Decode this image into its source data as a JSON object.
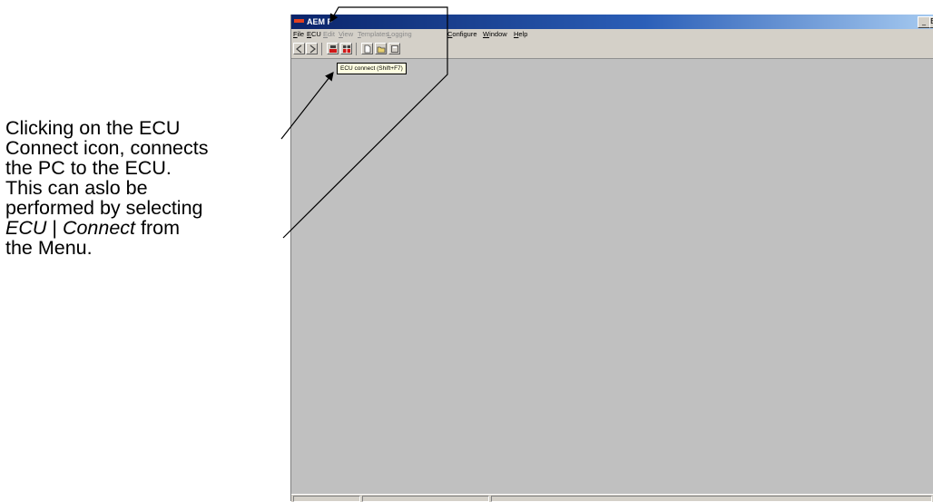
{
  "annotation": {
    "lines": [
      "Clicking on the ECU",
      "Connect icon, connects",
      "the PC to the ECU.",
      "This can aslo be",
      "performed by selecting"
    ],
    "italic_ecu": "ECU",
    "separator": " | ",
    "italic_connect": "Connect",
    "line6_suffix": " from",
    "line7": "the Menu."
  },
  "window": {
    "title": "AEM P",
    "min_glyph": "_",
    "max_glyph": "B",
    "titlebar_color": "#0a246a"
  },
  "menu": {
    "items": [
      {
        "label": "File",
        "mnemonic": "F",
        "rest": "ile",
        "enabled": true
      },
      {
        "label": "ECU",
        "mnemonic": "E",
        "rest": "CU",
        "enabled": true
      },
      {
        "label": "Edit",
        "mnemonic": "E",
        "rest": "dit",
        "enabled": false
      },
      {
        "label": "View",
        "mnemonic": "V",
        "rest": "iew",
        "enabled": false
      },
      {
        "label": "Templates",
        "mnemonic": "T",
        "rest": "emplates",
        "enabled": false
      },
      {
        "label": "Logging",
        "mnemonic": "L",
        "rest": "ogging",
        "enabled": false
      },
      {
        "label": "Configure",
        "mnemonic": "C",
        "rest": "onfigure",
        "enabled": true
      },
      {
        "label": "Window",
        "mnemonic": "W",
        "rest": "indow",
        "enabled": true
      },
      {
        "label": "Help",
        "mnemonic": "H",
        "rest": "elp",
        "enabled": true
      }
    ]
  },
  "toolbar": {
    "buttons": [
      "back-arrow-icon",
      "forward-arrow-icon",
      "ecu-connect-icon",
      "ecu-disconnect-icon",
      "new-file-icon",
      "open-file-icon",
      "save-file-icon"
    ],
    "accent_red": "#d01818"
  },
  "tooltip": {
    "text": "ECU connect (Shift+F7)"
  }
}
